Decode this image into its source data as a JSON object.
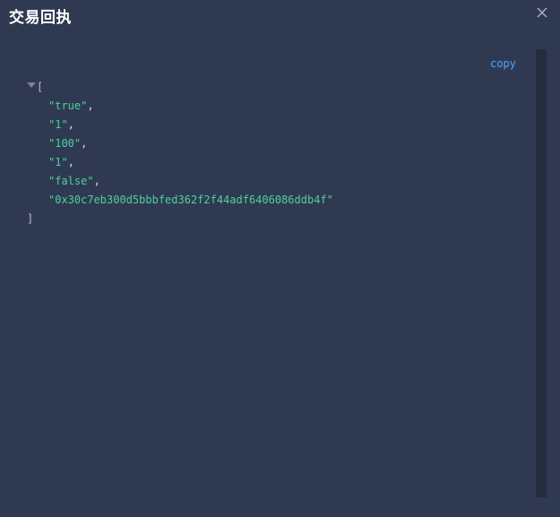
{
  "dialog": {
    "title": "交易回执",
    "close_icon": "close-icon",
    "copy_label": "copy"
  },
  "json_view": {
    "open_bracket": "[",
    "close_bracket": "]",
    "items": [
      {
        "value": "\"true\"",
        "comma": ","
      },
      {
        "value": "\"1\"",
        "comma": ","
      },
      {
        "value": "\"100\"",
        "comma": ","
      },
      {
        "value": "\"1\"",
        "comma": ","
      },
      {
        "value": "\"false\"",
        "comma": ","
      },
      {
        "value": "\"0x30c7eb300d5bbbfed362f2f44adf6406086ddb4f\"",
        "comma": ""
      }
    ]
  },
  "colors": {
    "background": "#2f3a52",
    "string_value": "#4fcf9b",
    "link": "#4aa5ff"
  }
}
